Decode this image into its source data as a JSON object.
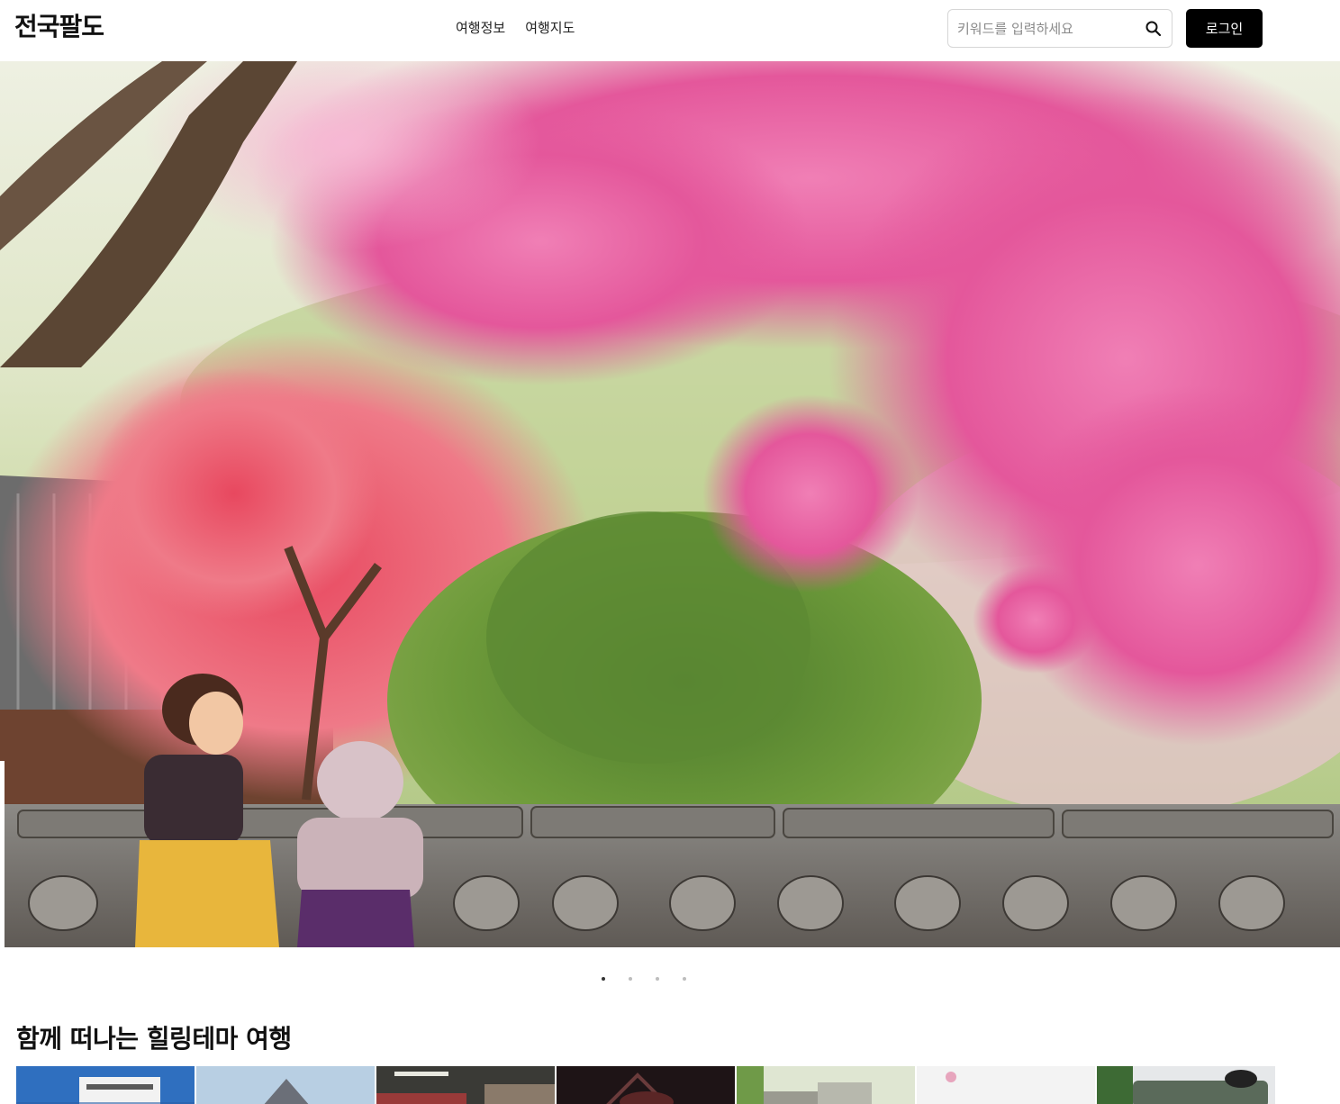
{
  "header": {
    "logo_text": "전국팔도",
    "nav": [
      "여행정보",
      "여행지도"
    ],
    "search_placeholder": "키워드를 입력하세요",
    "login_label": "로그인"
  },
  "hero": {
    "image_alt": "",
    "slide_count": 4,
    "active_slide": 1
  },
  "section": {
    "title": "함께 떠나는 힐링테마 여행",
    "thumbnails": [
      "",
      "",
      "",
      "",
      "",
      "",
      ""
    ]
  },
  "colors": {
    "login_button": "#000000",
    "dot_active": "#333333",
    "dot_inactive": "#bdbdbd"
  }
}
